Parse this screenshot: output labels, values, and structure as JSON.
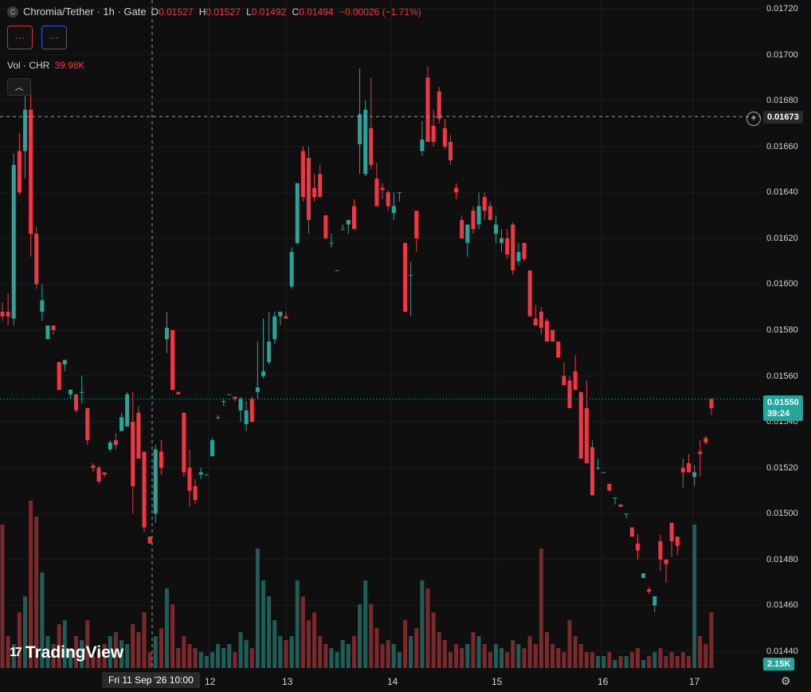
{
  "legend": {
    "symbol_icon": "C",
    "title": "Chromia/Tether · 1h · Gate",
    "ohlc": [
      {
        "k": "O",
        "v": "0.01527"
      },
      {
        "k": "H",
        "v": "0.01527"
      },
      {
        "k": "L",
        "v": "0.01492"
      },
      {
        "k": "C",
        "v": "0.01494"
      },
      {
        "k": "",
        "v": "−0.00026 (−1.71%)"
      }
    ]
  },
  "indicators": {
    "btn1": "···",
    "btn2": "···"
  },
  "volume_legend": {
    "label": "Vol · CHR",
    "value": "39.98K"
  },
  "collapse_icon": "︿",
  "price_axis": [
    "0.01720",
    "0.01700",
    "0.01680",
    "0.01660",
    "0.01640",
    "0.01620",
    "0.01600",
    "0.01580",
    "0.01560",
    "0.01540",
    "0.01520",
    "0.01500",
    "0.01480",
    "0.01460",
    "0.01440"
  ],
  "crosshair": {
    "price": "0.01673",
    "time": "Fri 11 Sep '26   10:00"
  },
  "last_price": {
    "price": "0.01550",
    "countdown": "39:24"
  },
  "volume_badge": "2.15K",
  "time_axis": [
    "12",
    "13",
    "14",
    "15",
    "16",
    "17"
  ],
  "branding": {
    "logo_text": "TradingView",
    "logo_mark": "17"
  },
  "colors": {
    "up": "#26a69a",
    "down": "#f23645",
    "vol_up": "#1d5f58",
    "vol_down": "#7a2a2d",
    "grid": "#1c1c1c"
  },
  "chart_data": {
    "type": "candlestick",
    "ylim": [
      0.01435,
      0.01722
    ],
    "candles": [
      [
        0.01588,
        0.01592,
        0.01584,
        0.01586
      ],
      [
        0.01588,
        0.01596,
        0.01582,
        0.01586
      ],
      [
        0.01585,
        0.01657,
        0.01582,
        0.01652
      ],
      [
        0.01658,
        0.01666,
        0.01639,
        0.0164
      ],
      [
        0.01658,
        0.01682,
        0.01646,
        0.01676
      ],
      [
        0.01676,
        0.01686,
        0.01612,
        0.01622
      ],
      [
        0.01622,
        0.01625,
        0.01598,
        0.016
      ],
      [
        0.01588,
        0.016,
        0.01584,
        0.01593
      ],
      [
        0.01576,
        0.01582,
        0.01576,
        0.01582
      ],
      [
        0.01582,
        0.01582,
        0.01578,
        0.0158
      ],
      [
        0.01566,
        0.01566,
        0.01554,
        0.01554
      ],
      [
        0.01565,
        0.01567,
        0.01562,
        0.01567
      ],
      [
        0.01552,
        0.01554,
        0.0155,
        0.01554
      ],
      [
        0.01552,
        0.01552,
        0.01544,
        0.01545
      ],
      [
        0.01553,
        0.0156,
        0.01548,
        0.01553
      ],
      [
        0.01546,
        0.01546,
        0.0153,
        0.01532
      ],
      [
        0.01521,
        0.01522,
        0.01518,
        0.0152
      ],
      [
        0.0152,
        0.01521,
        0.01513,
        0.01514
      ],
      [
        0.01518,
        0.01518,
        0.01516,
        0.01517
      ],
      [
        0.01528,
        0.01532,
        0.01527,
        0.01531
      ],
      [
        0.01532,
        0.01535,
        0.01528,
        0.0153
      ],
      [
        0.01536,
        0.01544,
        0.01536,
        0.01542
      ],
      [
        0.01538,
        0.01553,
        0.01538,
        0.01552
      ],
      [
        0.0154,
        0.01553,
        0.015,
        0.01512
      ],
      [
        0.01544,
        0.01547,
        0.0153,
        0.01524
      ],
      [
        0.01527,
        0.01527,
        0.01492,
        0.01494
      ],
      [
        0.0149,
        0.0149,
        0.01487,
        0.01487
      ],
      [
        0.015,
        0.0153,
        0.01496,
        0.01528
      ],
      [
        0.01527,
        0.01532,
        0.01517,
        0.0152
      ],
      [
        0.01576,
        0.01588,
        0.0157,
        0.01581
      ],
      [
        0.0158,
        0.0158,
        0.01554,
        0.01554
      ],
      [
        0.01553,
        0.01553,
        0.01552,
        0.01552
      ],
      [
        0.01544,
        0.01544,
        0.01516,
        0.01518
      ],
      [
        0.0152,
        0.01528,
        0.01503,
        0.0151
      ],
      [
        0.01512,
        0.01515,
        0.01504,
        0.01506
      ],
      [
        0.01517,
        0.0152,
        0.01515,
        0.01518
      ],
      [
        0.01517,
        0.01517,
        0.01517,
        0.01517
      ],
      [
        0.01525,
        0.01533,
        0.01525,
        0.01532
      ],
      [
        0.01542,
        0.01543,
        0.01541,
        0.01542
      ],
      [
        0.01549,
        0.0155,
        0.01547,
        0.01549
      ],
      [
        0.01552,
        0.01552,
        0.01552,
        0.01552
      ],
      [
        0.01551,
        0.01551,
        0.01549,
        0.0155
      ],
      [
        0.01545,
        0.01551,
        0.0154,
        0.0155
      ],
      [
        0.01539,
        0.01549,
        0.01536,
        0.01545
      ],
      [
        0.0155,
        0.01551,
        0.0154,
        0.0154
      ],
      [
        0.01553,
        0.01575,
        0.0155,
        0.01555
      ],
      [
        0.0156,
        0.01585,
        0.01559,
        0.01562
      ],
      [
        0.01566,
        0.01588,
        0.01565,
        0.01575
      ],
      [
        0.01576,
        0.01588,
        0.01574,
        0.01586
      ],
      [
        0.01586,
        0.01588,
        0.01582,
        0.01588
      ],
      [
        0.01586,
        0.01588,
        0.01585,
        0.01585
      ],
      [
        0.01599,
        0.01616,
        0.01598,
        0.01614
      ],
      [
        0.01618,
        0.01644,
        0.01617,
        0.01644
      ],
      [
        0.01658,
        0.0166,
        0.01636,
        0.01638
      ],
      [
        0.01655,
        0.0166,
        0.01622,
        0.01628
      ],
      [
        0.01642,
        0.01648,
        0.01636,
        0.01638
      ],
      [
        0.01648,
        0.01652,
        0.01641,
        0.01638
      ],
      [
        0.0163,
        0.0163,
        0.0162,
        0.0162
      ],
      [
        0.01618,
        0.01622,
        0.01616,
        0.01618
      ],
      [
        0.01606,
        0.01606,
        0.01606,
        0.01606
      ],
      [
        0.01624,
        0.01626,
        0.01624,
        0.01624
      ],
      [
        0.01626,
        0.01628,
        0.01622,
        0.01628
      ],
      [
        0.01634,
        0.01637,
        0.01624,
        0.01624
      ],
      [
        0.01661,
        0.01694,
        0.01648,
        0.01674
      ],
      [
        0.01648,
        0.0168,
        0.01647,
        0.01676
      ],
      [
        0.01668,
        0.0169,
        0.0165,
        0.01652
      ],
      [
        0.01646,
        0.01653,
        0.01636,
        0.01634
      ],
      [
        0.01642,
        0.01644,
        0.01637,
        0.01641
      ],
      [
        0.0164,
        0.01641,
        0.01632,
        0.01634
      ],
      [
        0.01631,
        0.0164,
        0.01628,
        0.01634
      ],
      [
        0.0164,
        0.0164,
        0.01636,
        0.0164
      ],
      [
        0.01618,
        0.01618,
        0.01588,
        0.01588
      ],
      [
        0.01604,
        0.0161,
        0.01586,
        0.01604
      ],
      [
        0.01632,
        0.01632,
        0.01614,
        0.0162
      ],
      [
        0.01658,
        0.01671,
        0.01656,
        0.01663
      ],
      [
        0.0169,
        0.01695,
        0.01663,
        0.01662
      ],
      [
        0.01669,
        0.01676,
        0.0166,
        0.01662
      ],
      [
        0.01684,
        0.01686,
        0.0167,
        0.01672
      ],
      [
        0.01668,
        0.01672,
        0.01659,
        0.0166
      ],
      [
        0.01662,
        0.01665,
        0.01652,
        0.01654
      ],
      [
        0.01642,
        0.01644,
        0.01637,
        0.0164
      ],
      [
        0.01628,
        0.0163,
        0.0162,
        0.0162
      ],
      [
        0.01618,
        0.01625,
        0.01612,
        0.01626
      ],
      [
        0.01632,
        0.01634,
        0.01622,
        0.01624
      ],
      [
        0.01626,
        0.0164,
        0.01624,
        0.01634
      ],
      [
        0.01638,
        0.0164,
        0.01628,
        0.01632
      ],
      [
        0.01634,
        0.01636,
        0.01628,
        0.01628
      ],
      [
        0.01622,
        0.0163,
        0.01618,
        0.01626
      ],
      [
        0.01618,
        0.01624,
        0.01614,
        0.0162
      ],
      [
        0.0162,
        0.01624,
        0.01611,
        0.01613
      ],
      [
        0.01626,
        0.01627,
        0.01604,
        0.01606
      ],
      [
        0.0161,
        0.01618,
        0.01608,
        0.01614
      ],
      [
        0.01618,
        0.01618,
        0.0161,
        0.01611
      ],
      [
        0.01606,
        0.01606,
        0.01588,
        0.01586
      ],
      [
        0.01585,
        0.01591,
        0.01582,
        0.01582
      ],
      [
        0.01588,
        0.0159,
        0.01578,
        0.01581
      ],
      [
        0.01584,
        0.01585,
        0.01575,
        0.01575
      ],
      [
        0.0158,
        0.0158,
        0.01575,
        0.01575
      ],
      [
        0.01575,
        0.01575,
        0.0157,
        0.01568
      ],
      [
        0.0156,
        0.01566,
        0.0156,
        0.01556
      ],
      [
        0.01558,
        0.0156,
        0.01546,
        0.01546
      ],
      [
        0.01562,
        0.01569,
        0.01554,
        0.01554
      ],
      [
        0.01553,
        0.0155,
        0.01524,
        0.01524
      ],
      [
        0.01546,
        0.01558,
        0.01534,
        0.01522
      ],
      [
        0.01529,
        0.01532,
        0.01508,
        0.01508
      ],
      [
        0.0152,
        0.01524,
        0.01519,
        0.0152
      ],
      [
        0.01518,
        0.01518,
        0.01518,
        0.01518
      ],
      [
        0.01513,
        0.01513,
        0.0151,
        0.0151
      ],
      [
        0.01507,
        0.01507,
        0.01504,
        0.01507
      ],
      [
        0.01504,
        0.01504,
        0.01503,
        0.01503
      ],
      [
        0.015,
        0.015,
        0.01498,
        0.015
      ],
      [
        0.01494,
        0.01494,
        0.0149,
        0.0149
      ],
      [
        0.01487,
        0.01491,
        0.0148,
        0.01484
      ],
      [
        0.01472,
        0.01474,
        0.01472,
        0.01474
      ],
      [
        0.01467,
        0.01468,
        0.01465,
        0.01466
      ],
      [
        0.0146,
        0.0146,
        0.01457,
        0.01464
      ],
      [
        0.01488,
        0.01491,
        0.01475,
        0.0148
      ],
      [
        0.0148,
        0.0148,
        0.0147,
        0.01478
      ],
      [
        0.01496,
        0.01496,
        0.01481,
        0.01488
      ],
      [
        0.0149,
        0.0149,
        0.01482,
        0.01486
      ],
      [
        0.0152,
        0.01524,
        0.01511,
        0.01518
      ],
      [
        0.01522,
        0.01526,
        0.01518,
        0.01518
      ],
      [
        0.01516,
        0.01521,
        0.01512,
        0.01518
      ],
      [
        0.01527,
        0.01532,
        0.01516,
        0.01526
      ],
      [
        0.01533,
        0.01534,
        0.0153,
        0.01531
      ],
      [
        0.0155,
        0.0155,
        0.01543,
        0.01546
      ]
    ],
    "volume_note": "bars colored per candle direction"
  }
}
